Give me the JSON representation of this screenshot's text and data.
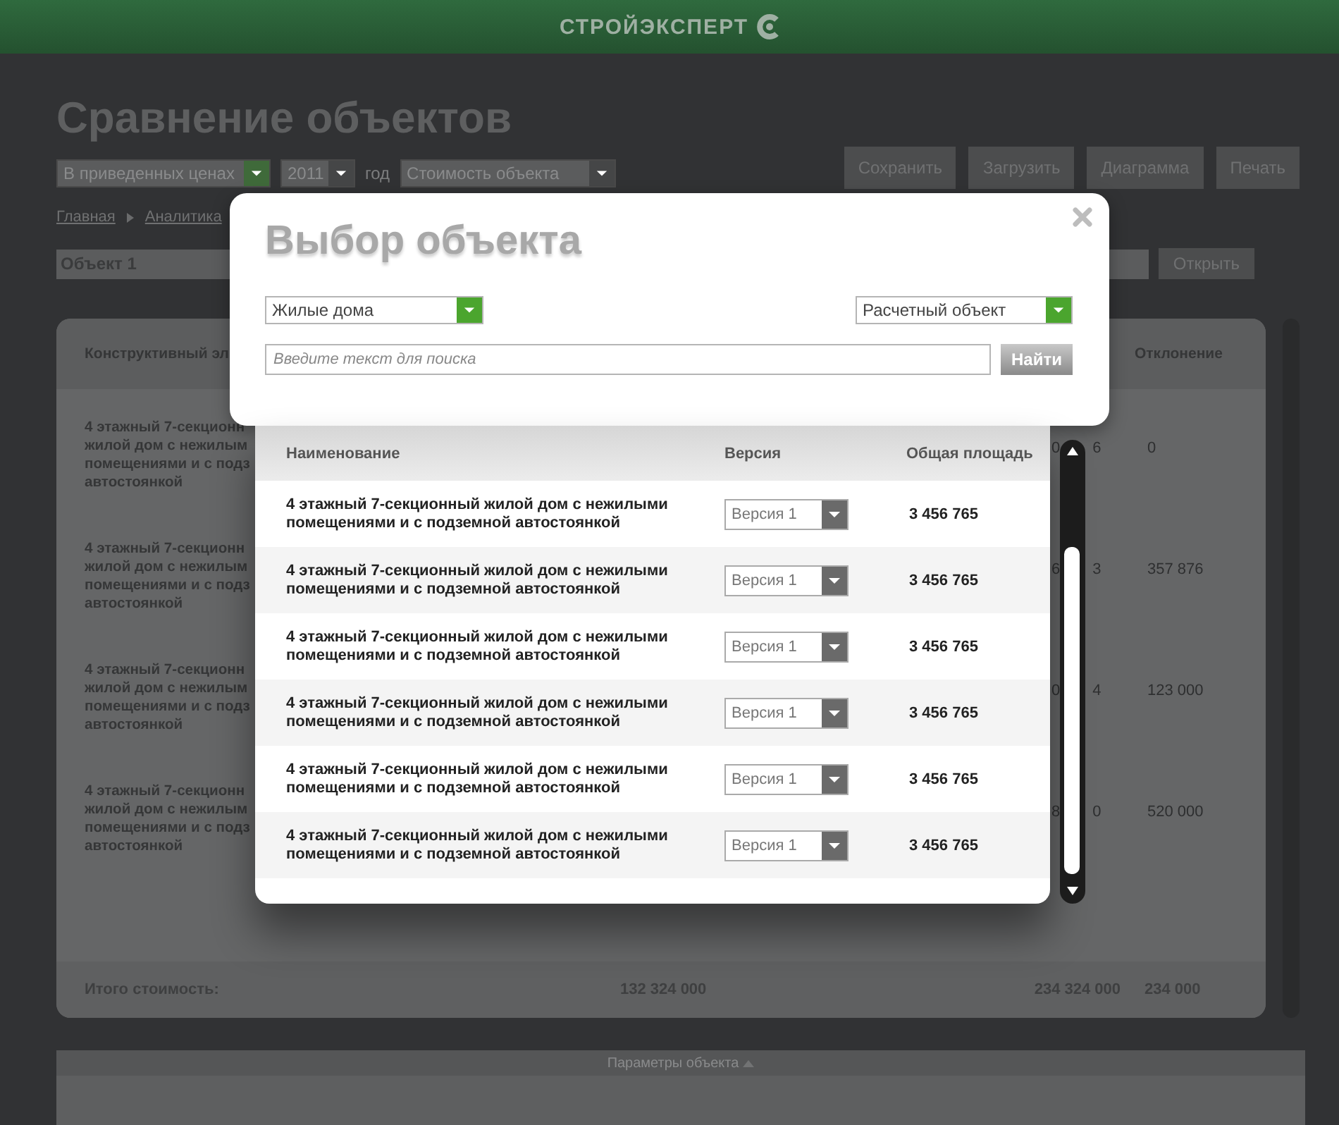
{
  "header": {
    "logo": "СТРОЙЭКСПЕРТ"
  },
  "page": {
    "title": "Сравнение объектов",
    "filters": [
      {
        "kind": "select-accent",
        "value": "В приведенных ценах"
      },
      {
        "kind": "select",
        "value": "2011"
      },
      {
        "kind": "label",
        "value": "год"
      },
      {
        "kind": "select",
        "value": "Стоимость объекта"
      }
    ],
    "actions": [
      "Сохранить",
      "Загрузить",
      "Диаграмма",
      "Печать"
    ],
    "breadcrumbs": [
      "Главная",
      "Аналитика"
    ],
    "object_field": {
      "value": "Объект 1"
    },
    "open_button": "Открыть"
  },
  "table": {
    "columns": [
      "Конструктивный эл",
      "Отклонение"
    ],
    "rows": [
      {
        "lines": [
          "4 этажный 7-секционн",
          "жилой дом с нежилым",
          "помещениями и с подз",
          "автостоянкой"
        ],
        "fragments": [
          "0",
          "6"
        ],
        "deviation": "0"
      },
      {
        "lines": [
          "4 этажный 7-секционн",
          "жилой дом с нежилым",
          "помещениями и с подз",
          "автостоянкой"
        ],
        "fragments": [
          "6",
          "3"
        ],
        "deviation": "357 876"
      },
      {
        "lines": [
          "4 этажный 7-секционн",
          "жилой дом с нежилым",
          "помещениями и с подз",
          "автостоянкой"
        ],
        "fragments": [
          "0",
          "4"
        ],
        "deviation": "123 000"
      },
      {
        "lines": [
          "4 этажный 7-секционн",
          "жилой дом с нежилым",
          "помещениями и с подз",
          "автостоянкой"
        ],
        "fragments": [
          "8",
          "0"
        ],
        "deviation": "520 000"
      }
    ],
    "total": {
      "label": "Итого стоимость:",
      "values": [
        "132 324 000",
        "234 324 000",
        "234 000"
      ]
    }
  },
  "bottom_panel": {
    "label": "Параметры объекта"
  },
  "modal": {
    "title": "Выбор объекта",
    "filters": [
      {
        "value": "Жилые дома"
      },
      {
        "value": "Расчетный объект"
      }
    ],
    "search": {
      "placeholder": "Введите текст для поиска"
    },
    "search_button": "Найти",
    "columns": [
      "Наименование",
      "Версия",
      "Общая площадь"
    ],
    "rows": [
      {
        "name": "4 этажный 7-секционный жилой дом с нежилыми помещениями и с подземной автостоянкой",
        "version": "Версия 1",
        "area": "3 456 765"
      },
      {
        "name": "4 этажный 7-секционный жилой дом с нежилыми помещениями и с подземной автостоянкой",
        "version": "Версия 1",
        "area": "3 456 765"
      },
      {
        "name": "4 этажный 7-секционный жилой дом с нежилыми помещениями и с подземной автостоянкой",
        "version": "Версия 1",
        "area": "3 456 765"
      },
      {
        "name": "4 этажный 7-секционный жилой дом с нежилыми помещениями и с подземной автостоянкой",
        "version": "Версия 1",
        "area": "3 456 765"
      },
      {
        "name": "4 этажный 7-секционный жилой дом с нежилыми помещениями и с подземной автостоянкой",
        "version": "Версия 1",
        "area": "3 456 765"
      },
      {
        "name": "4 этажный 7-секционный жилой дом с нежилыми помещениями и с подземной автостоянкой",
        "version": "Версия 1",
        "area": "3 456 765"
      }
    ]
  }
}
